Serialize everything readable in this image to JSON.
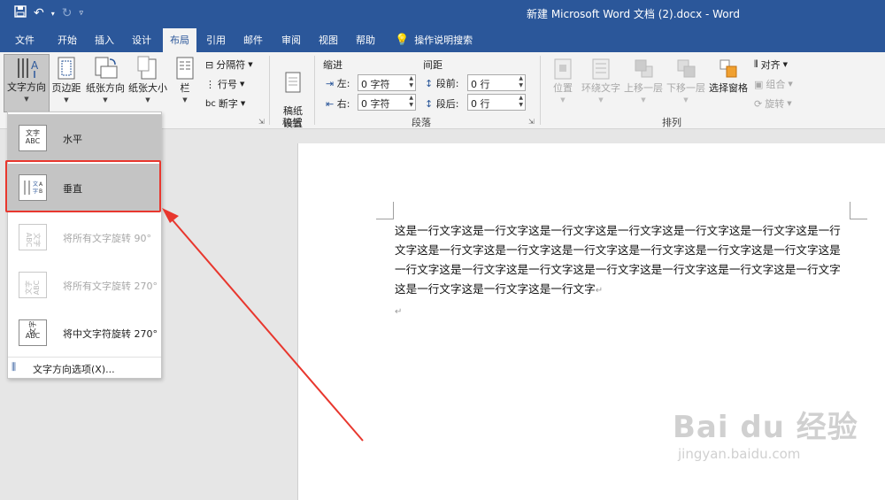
{
  "window": {
    "title": "新建 Microsoft Word 文档 (2).docx  -  Word"
  },
  "menu": {
    "tabs": [
      "文件",
      "开始",
      "插入",
      "设计",
      "布局",
      "引用",
      "邮件",
      "审阅",
      "视图",
      "帮助"
    ],
    "active": "布局",
    "tell_me": "操作说明搜索"
  },
  "ribbon": {
    "page_setup": {
      "text_direction": "文字方向",
      "margins": "页边距",
      "orientation": "纸张方向",
      "size": "纸张大小",
      "columns": "栏",
      "breaks": "分隔符",
      "line_numbers": "行号",
      "hyphenation": "断字"
    },
    "manuscript": {
      "button": "稿纸\n设置",
      "group": "稿纸"
    },
    "paragraph": {
      "indent_title": "缩进",
      "spacing_title": "间距",
      "left_label": "左:",
      "right_label": "右:",
      "before_label": "段前:",
      "after_label": "段后:",
      "left_value": "0 字符",
      "right_value": "0 字符",
      "before_value": "0 行",
      "after_value": "0 行",
      "group": "段落"
    },
    "arrange": {
      "position": "位置",
      "wrap_text": "环绕文字",
      "bring_forward": "上移一层",
      "send_backward": "下移一层",
      "selection_pane": "选择窗格",
      "align": "对齐",
      "group_btn": "组合",
      "rotate": "旋转",
      "group": "排列"
    }
  },
  "dropdown": {
    "items": [
      {
        "label": "水平",
        "icon": "文字\nABC"
      },
      {
        "label": "垂直",
        "icon": ""
      },
      {
        "label": "将所有文字旋转 90°",
        "icon": ""
      },
      {
        "label": "将所有文字旋转 270°",
        "icon": ""
      },
      {
        "label": "将中文字符旋转 270°",
        "icon": ""
      }
    ],
    "footer": "文字方向选项(X)..."
  },
  "document": {
    "paragraph": "这是一行文字这是一行文字这是一行文字这是一行文字这是一行文字这是一行文字这是一行文字这是一行文字这是一行文字这是一行文字这是一行文字这是一行文字这是一行文字这是一行文字这是一行文字这是一行文字这是一行文字这是一行文字这是一行文字这是一行文字这是一行文字这是一行文字这是一行文字"
  },
  "watermark": {
    "brand": "Bai du 经验",
    "url": "jingyan.baidu.com"
  },
  "colors": {
    "word_blue": "#2b579a",
    "highlight_red": "#e8372e"
  }
}
